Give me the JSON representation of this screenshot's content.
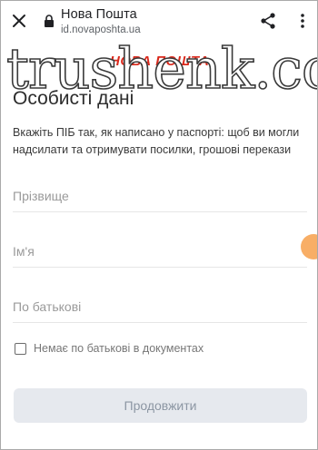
{
  "browser": {
    "title": "Нова Пошта",
    "url": "id.novaposhta.ua"
  },
  "watermark": "trushenk.com",
  "logo_text": "НОВА ПОШТА",
  "page": {
    "heading": "Особисті дані",
    "description": "Вкажіть ПІБ так, як написано у паспорті: щоб ви могли надсилати та отримувати посилки, грошові перекази"
  },
  "form": {
    "surname_placeholder": "Прізвище",
    "name_placeholder": "Ім'я",
    "patronymic_placeholder": "По батькові",
    "no_patronymic_label": "Немає по батькові в документах",
    "continue_label": "Продовжити"
  },
  "colors": {
    "brand_red": "#da291c",
    "accent_orange": "#f7a04b",
    "button_disabled_bg": "#e6e9ee"
  }
}
